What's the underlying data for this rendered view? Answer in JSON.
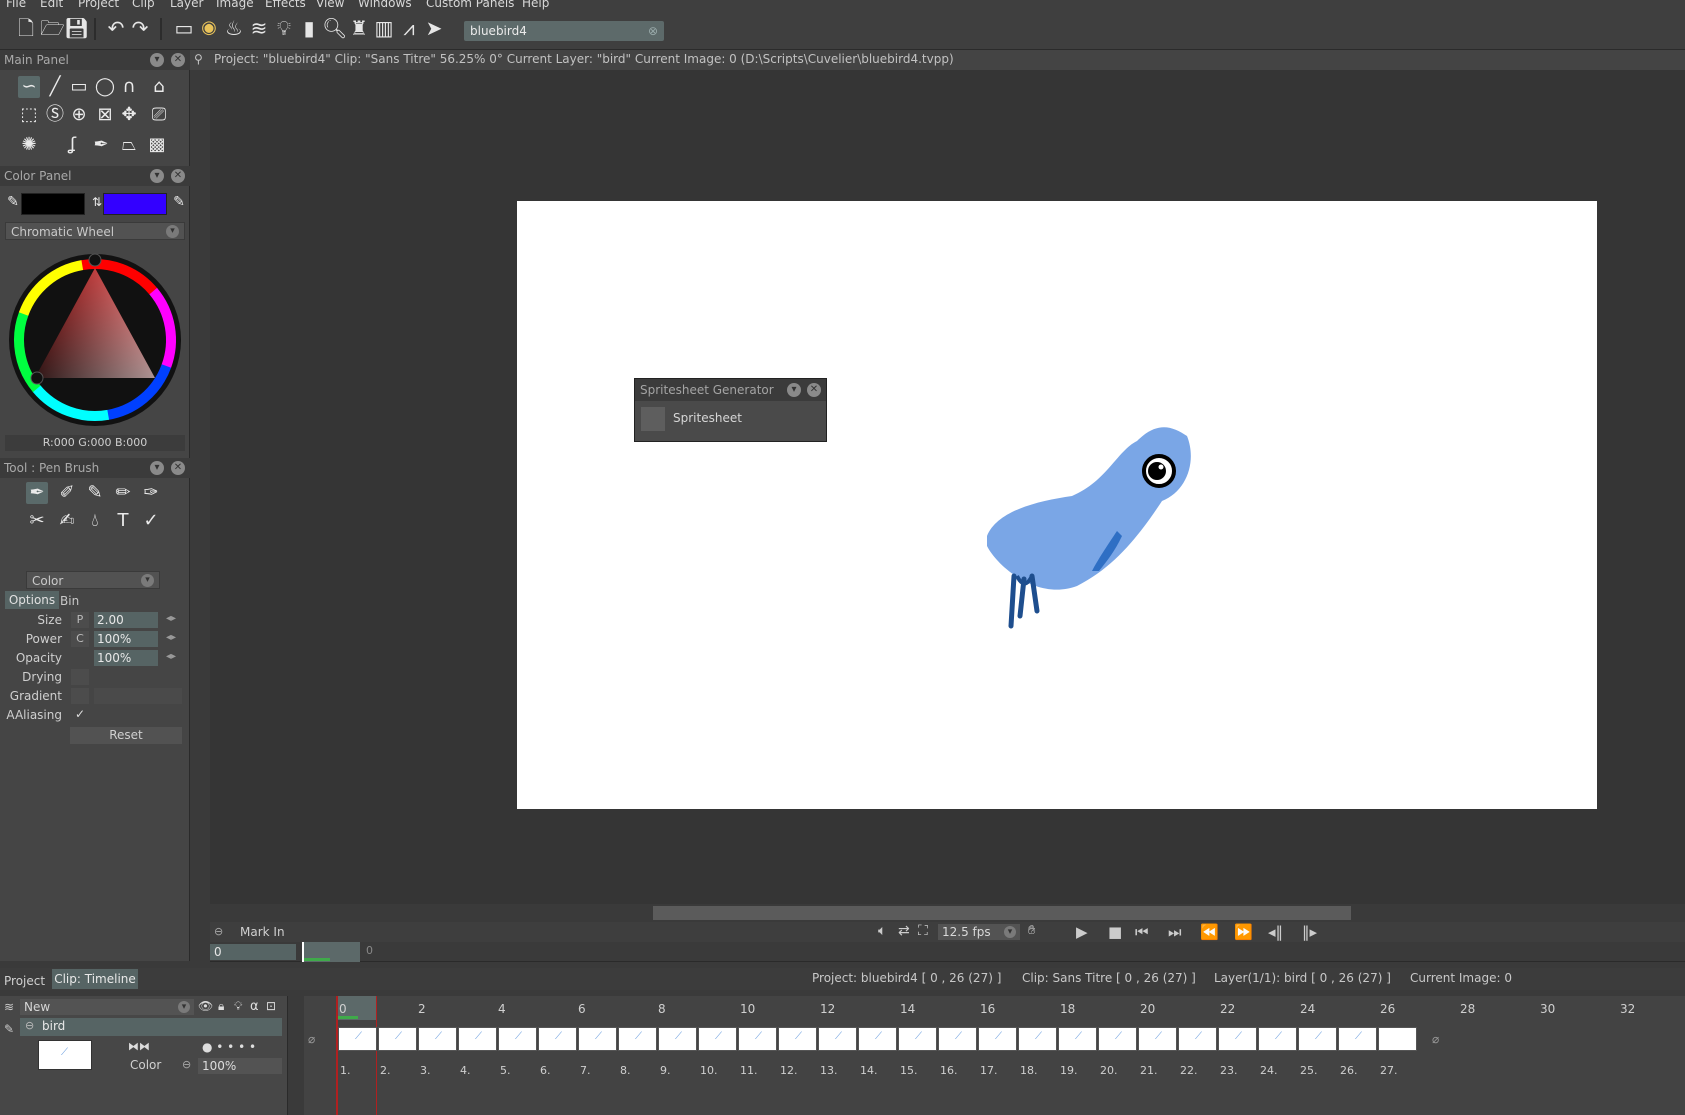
{
  "menu": [
    "File",
    "Edit",
    "Project",
    "Clip",
    "Layer",
    "Image",
    "Effects",
    "View",
    "Windows",
    "Custom Panels",
    "Help"
  ],
  "toolbar": {
    "project_field": "bluebird4"
  },
  "main_panel": {
    "title": "Main Panel"
  },
  "color_panel": {
    "title": "Color Panel",
    "primary_color": "#000000",
    "secondary_color": "#3300ff",
    "mode": "Chromatic Wheel",
    "rgb_readout": "R:000 G:000 B:000"
  },
  "tool_panel": {
    "title": "Tool : Pen Brush",
    "color_mode": "Color",
    "tabs": [
      "Options",
      "Bin"
    ],
    "size_label": "Size",
    "size_mode": "P",
    "size_value": "2.00",
    "power_label": "Power",
    "power_mode": "C",
    "power_value": "100%",
    "opacity_label": "Opacity",
    "opacity_value": "100%",
    "drying_label": "Drying",
    "gradient_label": "Gradient",
    "aaliasing_label": "AAliasing",
    "aaliasing_check": "✓",
    "reset_label": "Reset"
  },
  "infobar": {
    "text": "Project:  \"bluebird4\"  Clip: \"Sans Titre\"   56.25%   0°  Current Layer: \"bird\"  Current Image: 0 (D:\\Scripts\\Cuvelier\\bluebird4.tvpp)"
  },
  "sprite_panel": {
    "title": "Spritesheet Generator",
    "item": "Spritesheet"
  },
  "transport": {
    "mark_in": "Mark In",
    "fps": "12.5 fps",
    "current_frame": "0",
    "ruler_zero": "0"
  },
  "timeline": {
    "tabs": [
      "Project",
      "Clip: Timeline"
    ],
    "project_info": "Project: bluebird4 [ 0 , 26  (27) ]",
    "clip_info": "Clip: Sans Titre [ 0 , 26  (27) ]",
    "layer_info": "Layer(1/1): bird [ 0 , 26  (27) ]",
    "current_image": "Current Image: 0",
    "layer_group": "New",
    "layer_name": "bird",
    "blend_mode": "Color",
    "layer_opacity": "100%",
    "ticks": [
      "0",
      "2",
      "4",
      "6",
      "8",
      "10",
      "12",
      "14",
      "16",
      "18",
      "20",
      "22",
      "24",
      "26",
      "28",
      "30",
      "32"
    ],
    "frame_labels": [
      "1.",
      "2.",
      "3.",
      "4.",
      "5.",
      "6.",
      "7.",
      "8.",
      "9.",
      "10.",
      "11.",
      "12.",
      "13.",
      "14.",
      "15.",
      "16.",
      "17.",
      "18.",
      "19.",
      "20.",
      "21.",
      "22.",
      "23.",
      "24.",
      "25.",
      "26.",
      "27."
    ]
  },
  "colors": {
    "accent": "#5a6a6a",
    "bird_blue": "#7aa6e6",
    "bird_dark": "#1f4f9a"
  }
}
